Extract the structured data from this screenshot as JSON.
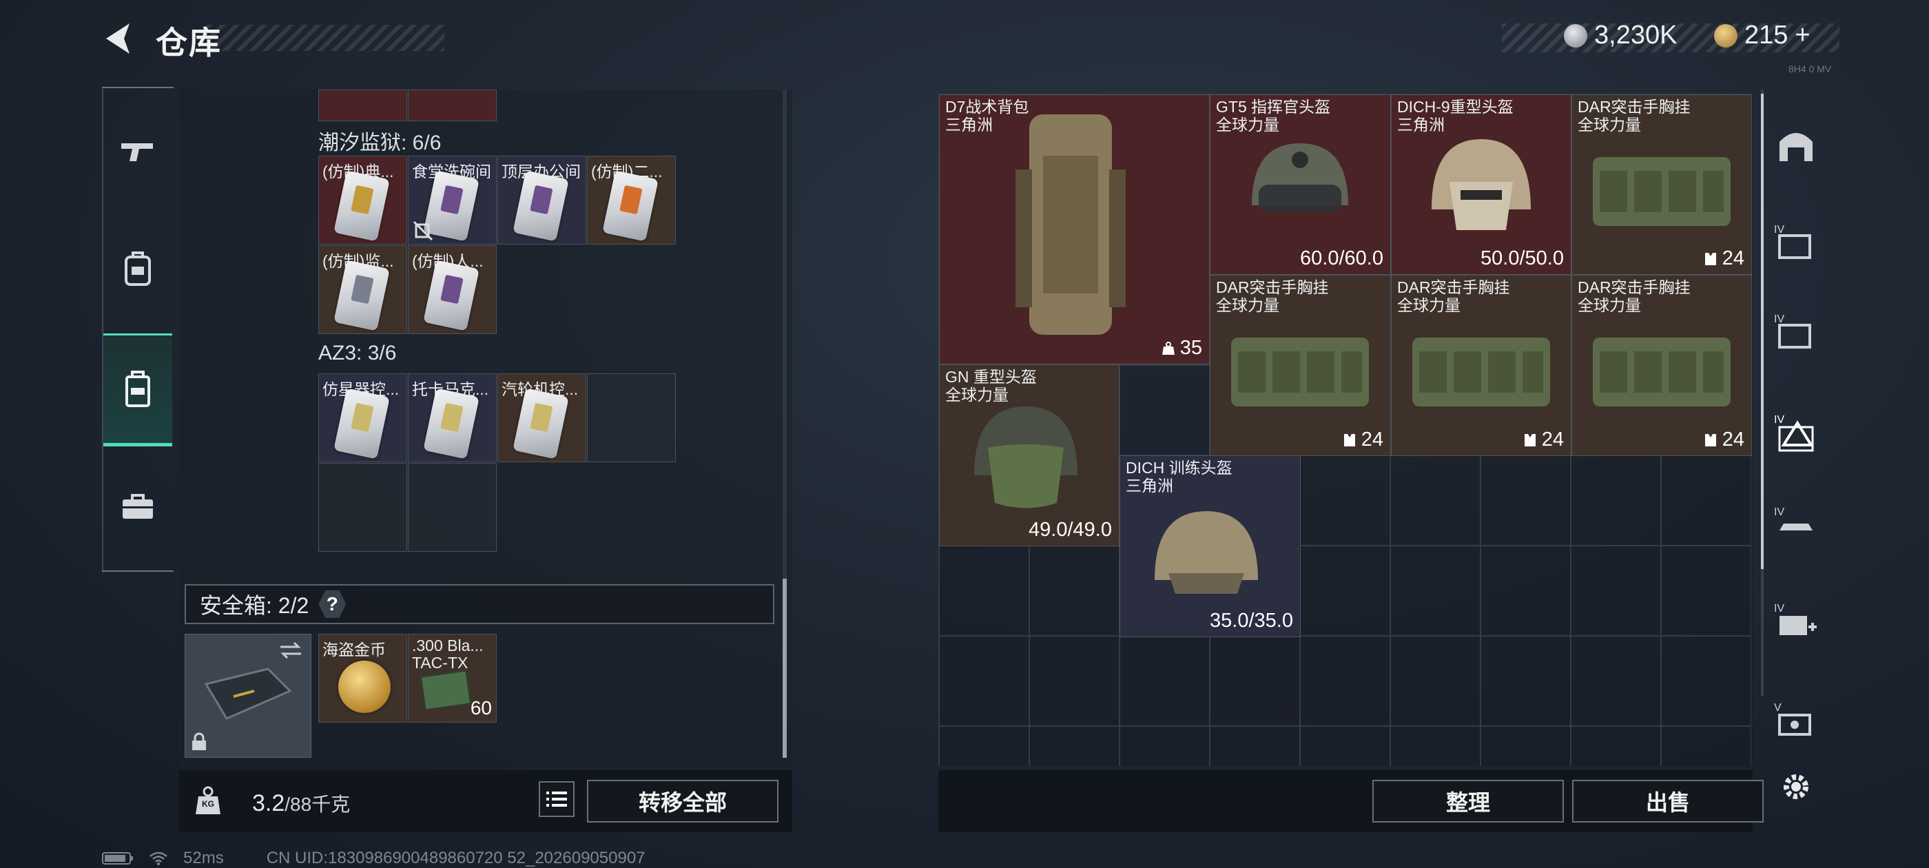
{
  "header": {
    "title": "仓库",
    "currency_1": "3,230K",
    "currency_2": "215",
    "currency_2_plus": "+",
    "version": "8H4 0 MV"
  },
  "left_rail": [
    "pistol-icon",
    "backpack-icon",
    "rig-icon",
    "briefcase-icon"
  ],
  "left_panel": {
    "section_1": "潮汐监狱: 6/6",
    "section_1_items": [
      "(仿制)典...",
      "食堂洗碗间",
      "顶层办公间",
      "(仿制)二...",
      "(仿制)监...",
      "(仿制)人..."
    ],
    "section_2": "AZ3: 3/6",
    "section_2_items": [
      "仿星器控...",
      "托卡马克...",
      "汽轮机控..."
    ],
    "safe_title": "安全箱: 2/2",
    "safe_help": "?",
    "safe_items": [
      {
        "name": "海盗金币"
      },
      {
        "name": ".300 Bla...",
        "sub": "TAC-TX",
        "count": "60"
      }
    ]
  },
  "bottom_left": {
    "weight_current": "3.2",
    "weight_rest": "/88千克",
    "kg_label": "KG",
    "transfer_all": "转移全部"
  },
  "right_items": [
    {
      "name": "D7战术背包",
      "sub": "三角洲",
      "value": "35"
    },
    {
      "name": "GT5 指挥官头盔",
      "sub": "全球力量",
      "value": "60.0/60.0"
    },
    {
      "name": "DICH-9重型头盔",
      "sub": "三角洲",
      "value": "50.0/50.0"
    },
    {
      "name": "DAR突击手胸挂",
      "sub": "全球力量",
      "value": "24"
    },
    {
      "name": "DAR突击手胸挂",
      "sub": "全球力量",
      "value": "24"
    },
    {
      "name": "DAR突击手胸挂",
      "sub": "全球力量",
      "value": "24"
    },
    {
      "name": "DAR突击手胸挂",
      "sub": "全球力量",
      "value": "24"
    },
    {
      "name": "GN 重型头盔",
      "sub": "全球力量",
      "value": "49.0/49.0"
    },
    {
      "name": "DICH 训练头盔",
      "sub": "三角洲",
      "value": "35.0/35.0"
    }
  ],
  "bottom_right": {
    "sort": "整理",
    "sell": "出售"
  },
  "status": {
    "ping": "52ms",
    "uid": "CN UID:1830986900489860720 52_202609050907"
  },
  "colors": {
    "accent": "#4fe0b8",
    "cell_red": "#4a2326",
    "cell_navy": "#2b2d40",
    "cell_brown": "#3e3129"
  }
}
